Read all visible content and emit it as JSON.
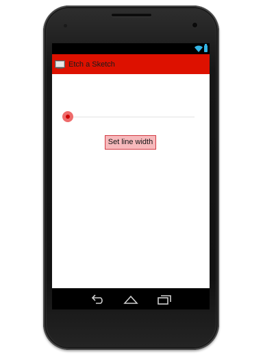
{
  "app": {
    "title": "Etch a Sketch"
  },
  "statusbar": {
    "icons": [
      "wifi-icon",
      "battery-icon"
    ],
    "accent_color": "#33b5e5"
  },
  "actionbar": {
    "background_color": "#dd1100",
    "icon": "app-icon"
  },
  "controls": {
    "line_width_slider": {
      "value_fraction": 0.0
    },
    "set_button_label": "Set line width",
    "button_color": "#f7b9bc"
  },
  "navbar": {
    "buttons": [
      "back-icon",
      "home-icon",
      "recent-apps-icon"
    ]
  }
}
